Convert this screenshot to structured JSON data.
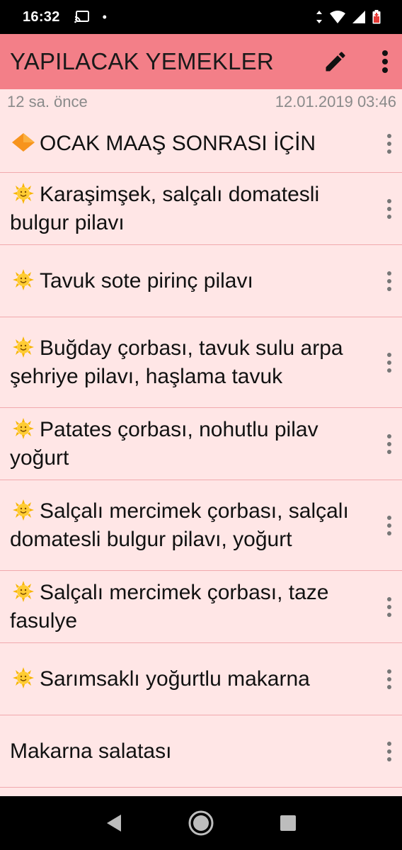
{
  "status_bar": {
    "time": "16:32",
    "dot": "•",
    "icons": [
      "cast-icon",
      "data-arrows-icon",
      "wifi-icon",
      "signal-icon",
      "battery-icon"
    ]
  },
  "app_bar": {
    "title": "YAPILACAK YEMEKLER",
    "background": "#f37f88",
    "actions": [
      "edit-icon",
      "more-vert-icon"
    ]
  },
  "meta": {
    "relative_time": "12 sa. önce",
    "timestamp": "12.01.2019 03:46"
  },
  "list": {
    "background": "#ffe6e6",
    "items": [
      {
        "icon": "diamond-icon",
        "text": "OCAK MAAŞ SONRASI İÇİN"
      },
      {
        "icon": "sun-icon",
        "text": "Karaşimşek, salçalı domatesli bulgur pilavı"
      },
      {
        "icon": "sun-icon",
        "text": "Tavuk sote pirinç pilavı"
      },
      {
        "icon": "sun-icon",
        "text": "Buğday çorbası, tavuk sulu arpa şehriye pilavı, haşlama tavuk"
      },
      {
        "icon": "sun-icon",
        "text": "Patates çorbası, nohutlu pilav yoğurt"
      },
      {
        "icon": "sun-icon",
        "text": "Salçalı mercimek çorbası, salçalı domatesli bulgur pilavı, yoğurt"
      },
      {
        "icon": "sun-icon",
        "text": "Salçalı mercimek çorbası, taze fasulye"
      },
      {
        "icon": "sun-icon",
        "text": "Sarımsaklı yoğurtlu makarna"
      },
      {
        "icon": "",
        "text": "Makarna salatası"
      }
    ]
  },
  "nav_bar": {
    "buttons": [
      "back-icon",
      "home-icon",
      "recents-icon"
    ]
  }
}
